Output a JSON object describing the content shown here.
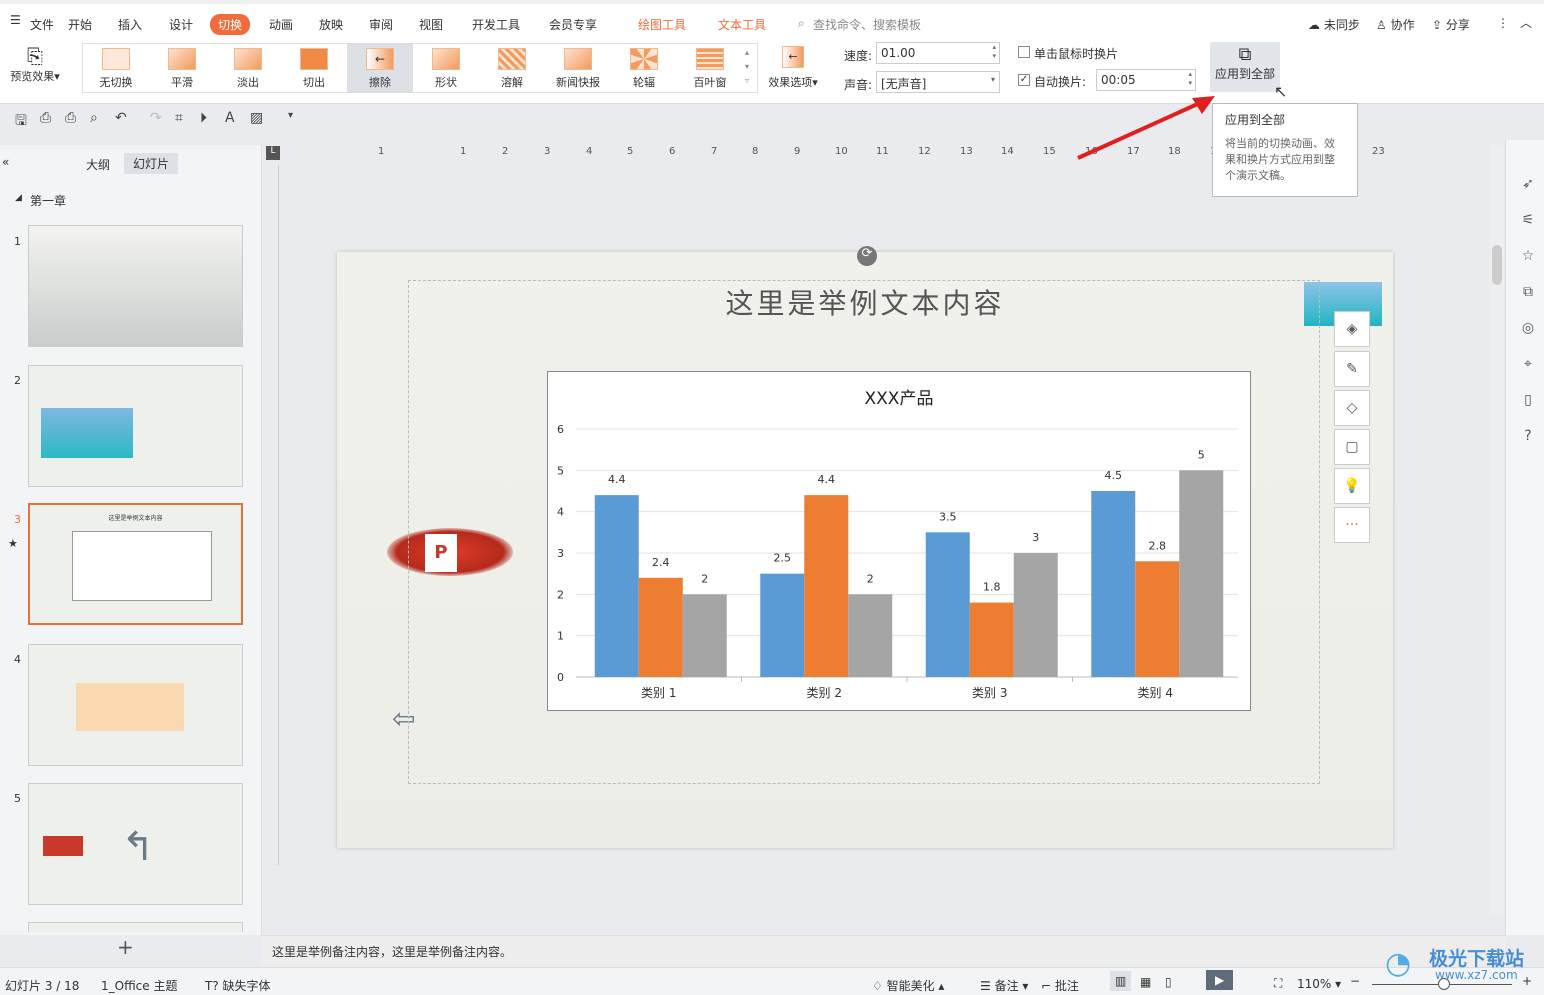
{
  "menu": {
    "file": "文件",
    "tabs": [
      "开始",
      "插入",
      "设计",
      "切换",
      "动画",
      "放映",
      "审阅",
      "视图",
      "开发工具",
      "会员专享"
    ],
    "active_tab": "切换",
    "context_tabs": [
      "绘图工具",
      "文本工具"
    ],
    "search": "查找命令、搜索模板",
    "sync": "未同步",
    "collab": "协作",
    "share": "分享"
  },
  "ribbon": {
    "preview": "预览效果",
    "transitions": [
      "无切换",
      "平滑",
      "淡出",
      "切出",
      "擦除",
      "形状",
      "溶解",
      "新闻快报",
      "轮辐",
      "百叶窗"
    ],
    "selected": "擦除",
    "effect_options": "效果选项",
    "speed_label": "速度:",
    "speed": "01.00",
    "sound_label": "声音:",
    "sound": "[无声音]",
    "on_click_label": "单击鼠标时换片",
    "on_click": false,
    "auto_label": "自动换片:",
    "auto": true,
    "auto_time": "00:05",
    "apply_all": "应用到全部"
  },
  "tooltip": {
    "title": "应用到全部",
    "body": "将当前的切换动画、效果和换片方式应用到整个演示文稿。"
  },
  "left_panel": {
    "tabs": [
      "大纲",
      "幻灯片"
    ],
    "active": "幻灯片",
    "section": "第一章",
    "slides": [
      "1",
      "2",
      "3",
      "4",
      "5"
    ],
    "selected": "3",
    "slide_title": "这里是举例文本内容"
  },
  "ruler": {
    "h": [
      "1",
      "1",
      "2",
      "3",
      "4",
      "5",
      "6",
      "7",
      "8",
      "9",
      "10",
      "11",
      "12",
      "13",
      "14",
      "15",
      "16",
      "17",
      "18",
      "19",
      "23"
    ]
  },
  "slide": {
    "title": "这里是举例文本内容"
  },
  "chart_data": {
    "type": "bar",
    "title": "XXX产品",
    "categories": [
      "类别 1",
      "类别 2",
      "类别 3",
      "类别 4"
    ],
    "series": [
      {
        "values": [
          4.4,
          2.5,
          3.5,
          4.5
        ],
        "color": "#5b9bd5"
      },
      {
        "values": [
          2.4,
          4.4,
          1.8,
          2.8
        ],
        "color": "#ed7d31"
      },
      {
        "values": [
          2,
          2,
          3,
          5
        ],
        "color": "#a5a5a5"
      }
    ],
    "ylim": [
      0,
      6
    ],
    "yticks": [
      "0",
      "1",
      "2",
      "3",
      "4",
      "5",
      "6"
    ],
    "grid": true,
    "data_labels": true
  },
  "notes": "这里是举例备注内容，这里是举例备注内容。",
  "status": {
    "slide": "幻灯片 3 / 18",
    "theme": "1_Office 主题",
    "missing_font": "缺失字体",
    "beautify": "智能美化",
    "notes": "备注",
    "comment": "批注",
    "zoom": "110%"
  },
  "watermark": "极光下载站 www.xz7.com"
}
